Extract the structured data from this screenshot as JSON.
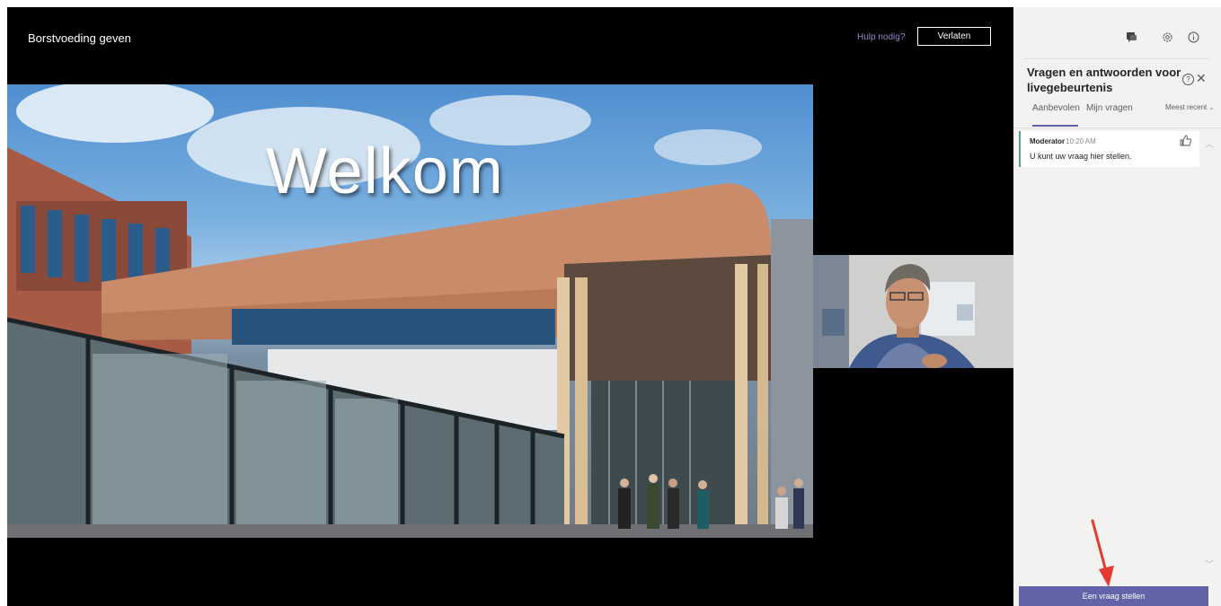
{
  "header": {
    "event_title": "Borstvoeding geven",
    "help_link": "Hulp nodig?",
    "leave_button": "Verlaten"
  },
  "slide": {
    "heading": "Welkom"
  },
  "panel": {
    "top_icons": [
      "chat-icon",
      "gear-icon",
      "info-icon"
    ],
    "title": "Vragen en antwoorden voor livegebeurtenis",
    "tabs": [
      {
        "label": "Aanbevolen",
        "active": true
      },
      {
        "label": "Mijn vragen",
        "active": false
      }
    ],
    "sort_label": "Meest recent",
    "questions": [
      {
        "author": "Moderator",
        "time": "10:20 AM",
        "text": "U kunt uw vraag hier stellen."
      }
    ],
    "ask_button": "Een vraag stellen"
  },
  "colors": {
    "accent": "#6264a7",
    "annotation_arrow": "#e8392f"
  }
}
